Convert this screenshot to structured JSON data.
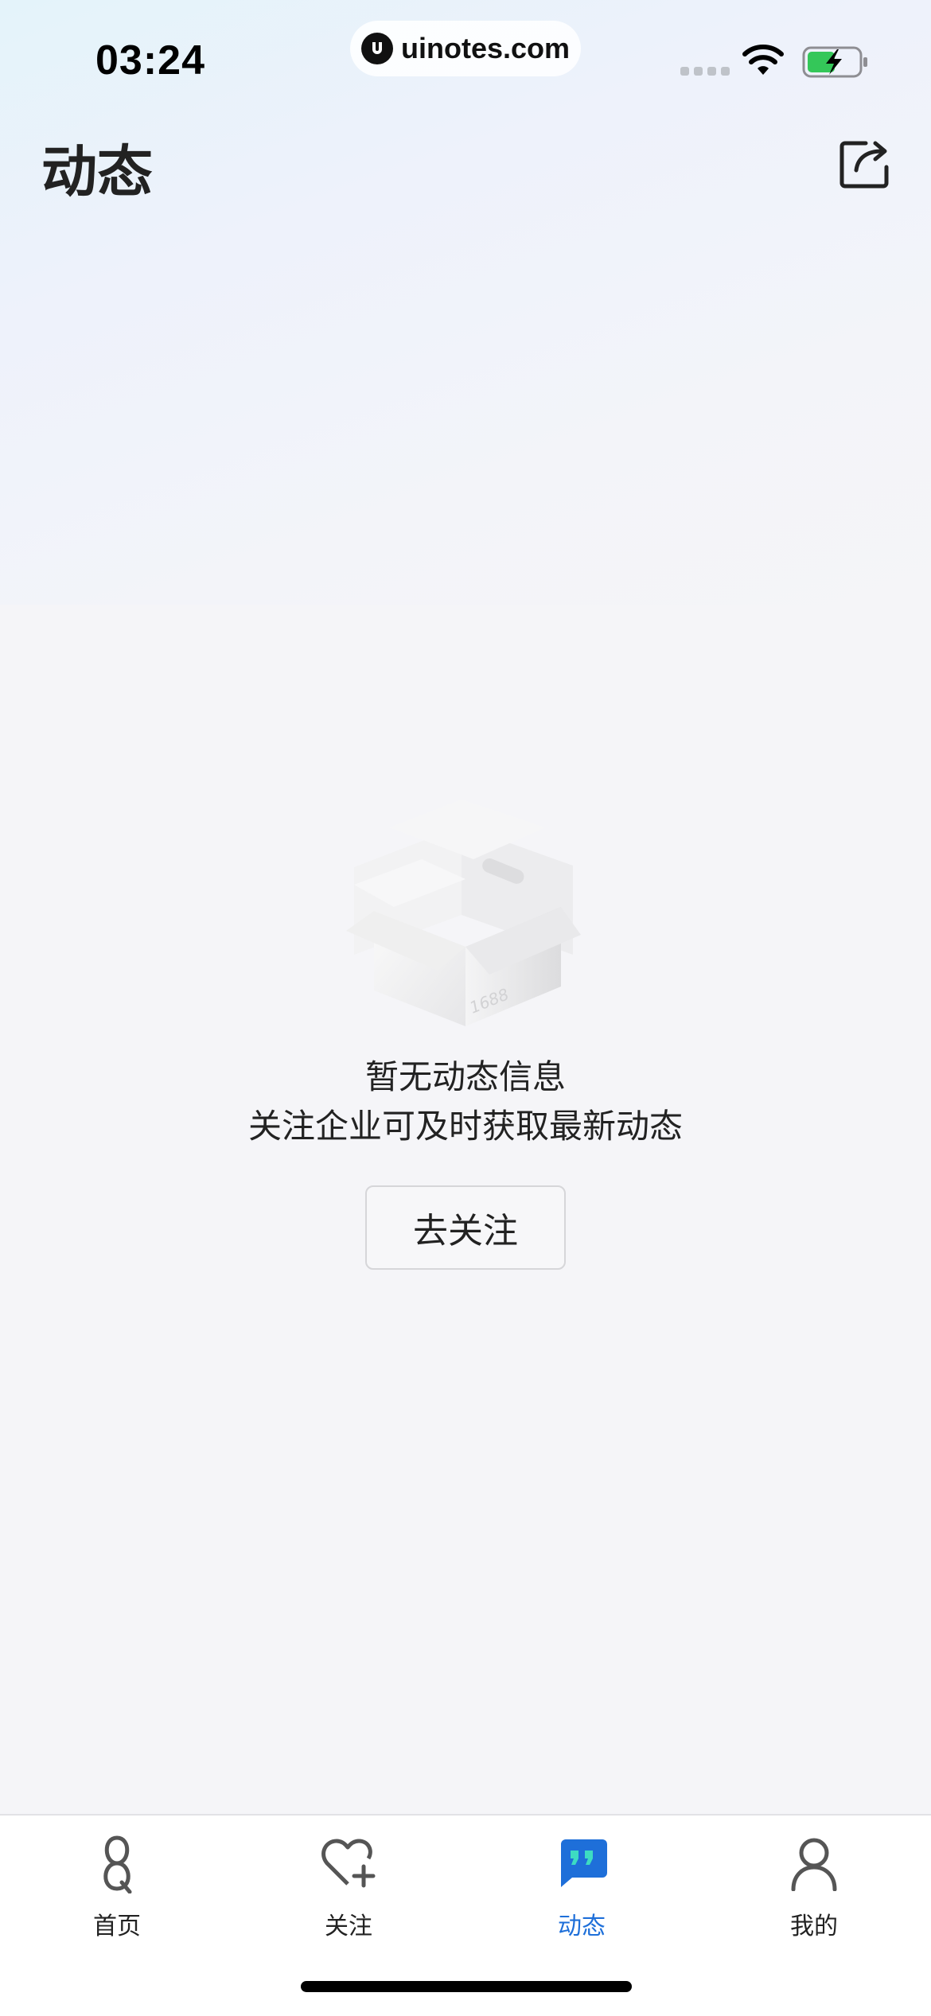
{
  "status_bar": {
    "time": "03:24",
    "url": "uinotes.com"
  },
  "header": {
    "title": "动态",
    "share_icon": "share-icon"
  },
  "empty_state": {
    "illustration_label": "1688",
    "title": "暂无动态信息",
    "subtitle": "关注企业可及时获取最新动态",
    "button_label": "去关注"
  },
  "tabbar": {
    "items": [
      {
        "label": "首页",
        "icon": "home-icon",
        "active": false
      },
      {
        "label": "关注",
        "icon": "heart-plus-icon",
        "active": false
      },
      {
        "label": "动态",
        "icon": "chat-quote-icon",
        "active": true
      },
      {
        "label": "我的",
        "icon": "person-icon",
        "active": false
      }
    ]
  },
  "colors": {
    "accent": "#1e6fd9",
    "battery_green": "#34c759",
    "text": "#222222"
  }
}
